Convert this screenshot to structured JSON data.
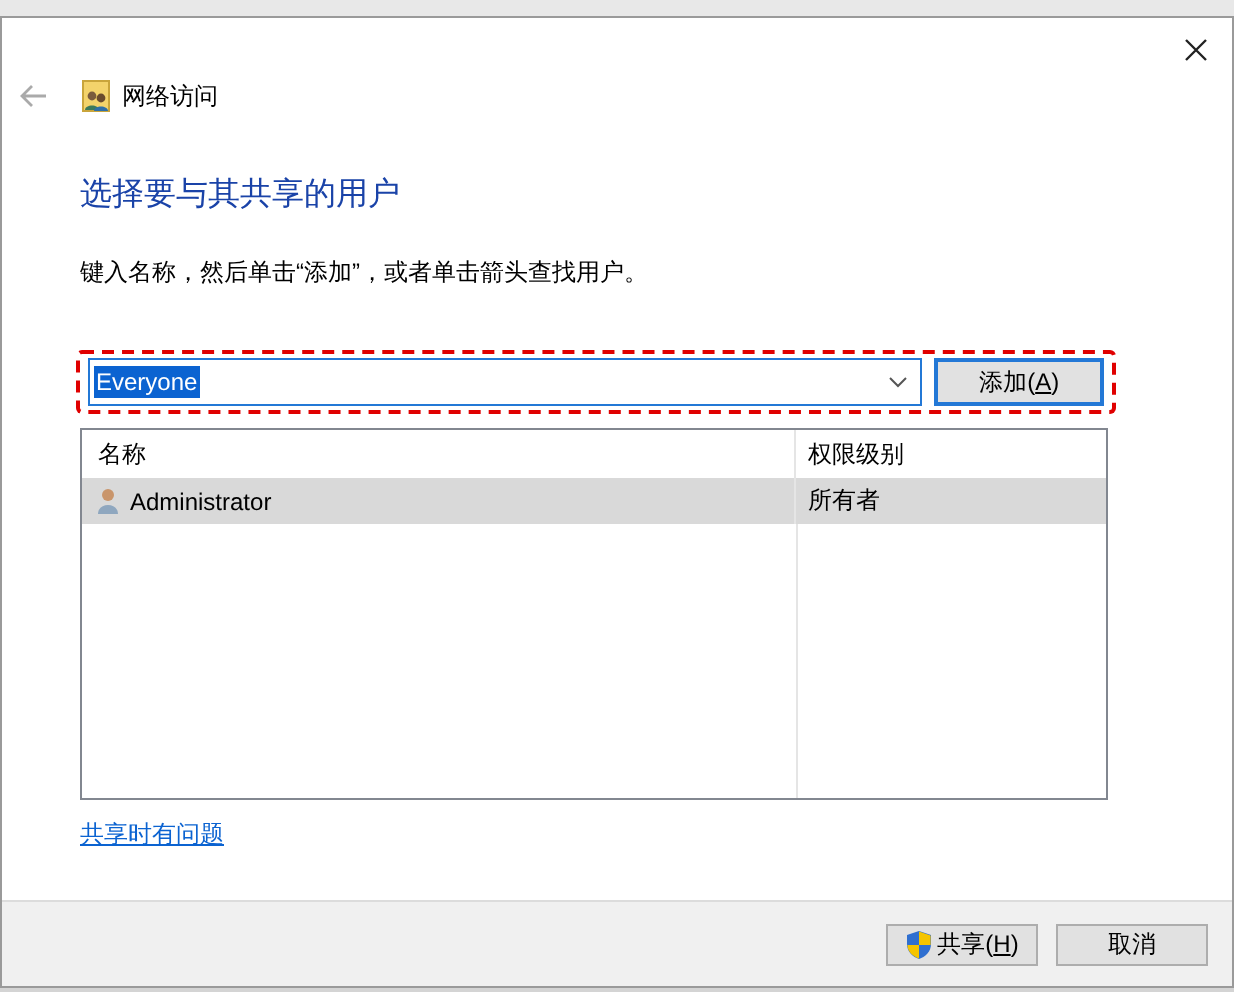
{
  "window": {
    "title": "网络访问"
  },
  "heading": "选择要与其共享的用户",
  "instruction": "键入名称，然后单击“添加”，或者单击箭头查找用户。",
  "user_field": {
    "value": "Everyone",
    "highlighted": true
  },
  "add_button": {
    "label_parts": [
      "添加(",
      "A",
      ")"
    ]
  },
  "table": {
    "columns": [
      "名称",
      "权限级别"
    ],
    "rows": [
      {
        "name": "Administrator",
        "permission": "所有者",
        "selected": true
      }
    ]
  },
  "help_link": "共享时有问题",
  "buttons": [
    {
      "kind": "shield",
      "label_parts": [
        "共享(",
        "H",
        ")"
      ]
    },
    {
      "kind": "plain",
      "label_parts": [
        "取消"
      ]
    }
  ]
}
